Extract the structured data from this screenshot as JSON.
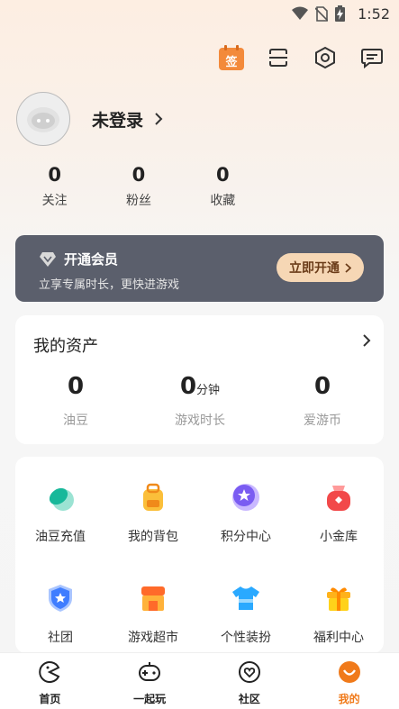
{
  "status": {
    "time": "1:52"
  },
  "profile": {
    "login_label": "未登录"
  },
  "stats": [
    {
      "value": "0",
      "label": "关注"
    },
    {
      "value": "0",
      "label": "粉丝"
    },
    {
      "value": "0",
      "label": "收藏"
    }
  ],
  "header": {
    "signin_icon_text": "签"
  },
  "vip": {
    "title": "开通会员",
    "subtitle": "立享专属时长，更快进游戏",
    "button": "立即开通"
  },
  "assets": {
    "title": "我的资产",
    "items": [
      {
        "value": "0",
        "unit": "",
        "label": "油豆"
      },
      {
        "value": "0",
        "unit": "分钟",
        "label": "游戏时长"
      },
      {
        "value": "0",
        "unit": "",
        "label": "爱游币"
      }
    ]
  },
  "grid": [
    {
      "label": "油豆充值",
      "icon": "bean-icon"
    },
    {
      "label": "我的背包",
      "icon": "backpack-icon"
    },
    {
      "label": "积分中心",
      "icon": "points-icon"
    },
    {
      "label": "小金库",
      "icon": "vault-icon"
    },
    {
      "label": "社团",
      "icon": "club-icon"
    },
    {
      "label": "游戏超市",
      "icon": "store-icon"
    },
    {
      "label": "个性装扮",
      "icon": "outfit-icon"
    },
    {
      "label": "福利中心",
      "icon": "gift-icon"
    }
  ],
  "tabs": [
    {
      "label": "首页",
      "active": false
    },
    {
      "label": "一起玩",
      "active": false
    },
    {
      "label": "社区",
      "active": false
    },
    {
      "label": "我的",
      "active": true
    }
  ],
  "colors": {
    "accent": "#f07a1a",
    "vip_bg": "#5b5f6c",
    "vip_button": "#f6d7b5"
  }
}
